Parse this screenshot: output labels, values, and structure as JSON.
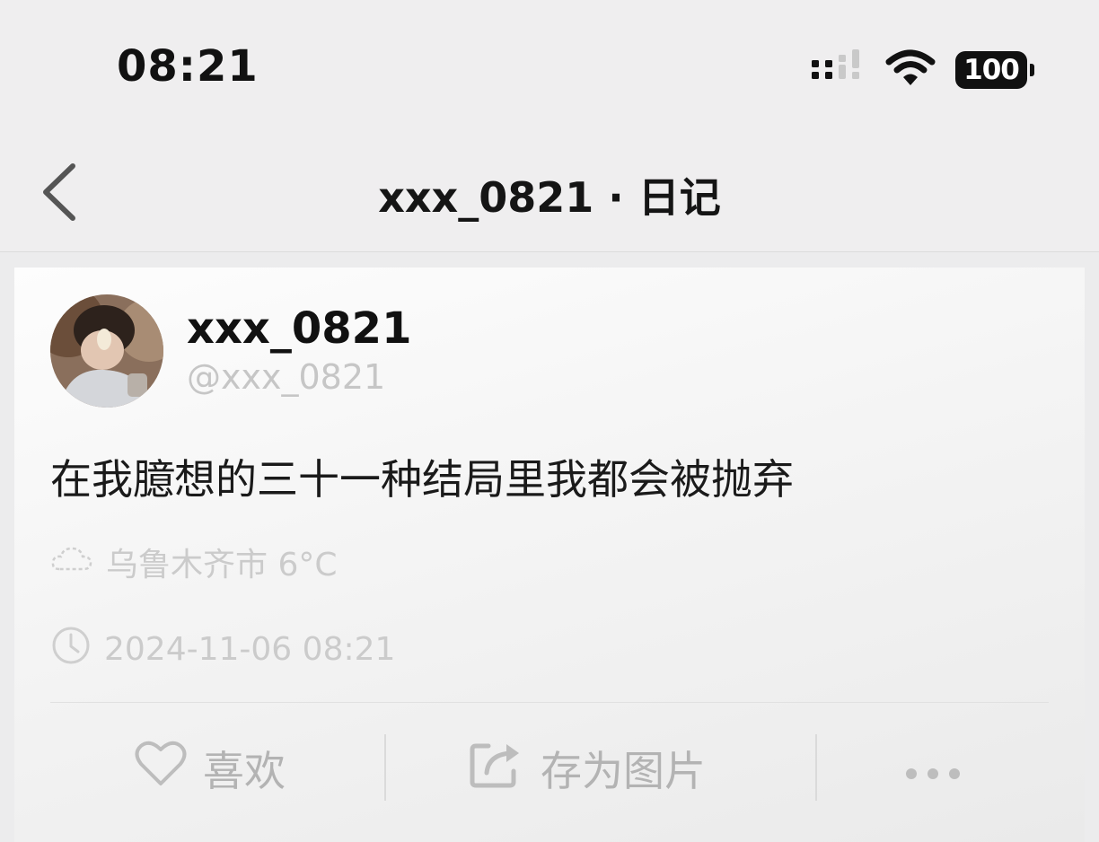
{
  "status_bar": {
    "time": "08:21",
    "battery_level": "100",
    "icons": [
      "signal-icon",
      "wifi-icon",
      "battery-icon"
    ]
  },
  "nav": {
    "back_icon": "chevron-left-icon",
    "title": "xxx_0821 · 日记"
  },
  "post": {
    "author_name": "xxx_0821",
    "author_handle": "@xxx_0821",
    "content": "在我臆想的三十一种结局里我都会被抛弃",
    "weather": "乌鲁木齐市 6°C",
    "weather_icon": "cloud-icon",
    "datetime": "2024-11-06 08:21",
    "datetime_icon": "clock-icon"
  },
  "actions": {
    "like_label": "喜欢",
    "like_icon": "heart-icon",
    "save_image_label": "存为图片",
    "save_image_icon": "share-icon",
    "more_icon": "more-icon"
  },
  "colors": {
    "background": "#efeeef",
    "card": "#f7f7f7",
    "primary_text": "#111111",
    "secondary_text": "#c6c6c6",
    "action_text": "#b3b3b3"
  }
}
